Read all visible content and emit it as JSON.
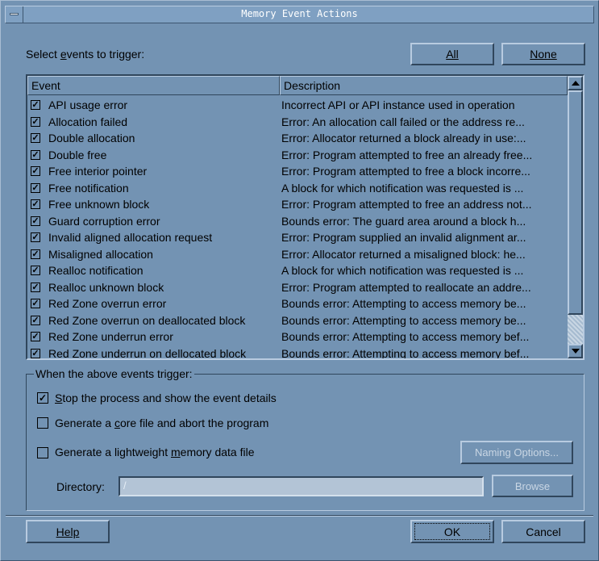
{
  "window": {
    "title": "Memory Event Actions"
  },
  "select_label_pre": "Select ",
  "select_label_ul": "e",
  "select_label_post": "vents to trigger:",
  "buttons": {
    "all": "All",
    "none": "None",
    "naming_options": "Naming Options...",
    "browse": "Browse",
    "help": "Help",
    "ok": "OK",
    "cancel": "Cancel"
  },
  "table": {
    "columns": [
      "Event",
      "Description"
    ],
    "rows": [
      {
        "event": "API usage error",
        "desc": "Incorrect API or API instance used in operation",
        "checked": true
      },
      {
        "event": "Allocation failed",
        "desc": "Error: An allocation call failed or the address re...",
        "checked": true
      },
      {
        "event": "Double allocation",
        "desc": "Error: Allocator returned a block already in use:...",
        "checked": true
      },
      {
        "event": "Double free",
        "desc": "Error: Program attempted to free an already free...",
        "checked": true
      },
      {
        "event": "Free interior pointer",
        "desc": "Error: Program attempted to free a block incorre...",
        "checked": true
      },
      {
        "event": "Free notification",
        "desc": "A block for which notification was requested is ...",
        "checked": true
      },
      {
        "event": "Free unknown block",
        "desc": "Error: Program attempted to free an address not...",
        "checked": true
      },
      {
        "event": "Guard corruption error",
        "desc": "Bounds error: The guard area around a block h...",
        "checked": true
      },
      {
        "event": "Invalid aligned allocation request",
        "desc": "Error: Program supplied an invalid alignment ar...",
        "checked": true
      },
      {
        "event": "Misaligned allocation",
        "desc": "Error: Allocator returned a misaligned block: he...",
        "checked": true
      },
      {
        "event": "Realloc notification",
        "desc": "A block for which notification was requested is ...",
        "checked": true
      },
      {
        "event": "Realloc unknown block",
        "desc": "Error: Program attempted to reallocate an addre...",
        "checked": true
      },
      {
        "event": "Red Zone overrun error",
        "desc": "Bounds error: Attempting to access memory be...",
        "checked": true
      },
      {
        "event": "Red Zone overrun on deallocated block",
        "desc": "Bounds error: Attempting to access memory be...",
        "checked": true
      },
      {
        "event": "Red Zone underrun error",
        "desc": "Bounds error: Attempting to access memory bef...",
        "checked": true
      },
      {
        "event": "Red Zone underrun on dellocated block",
        "desc": "Bounds error: Attempting to access memory bef...",
        "checked": true
      }
    ]
  },
  "group": {
    "title": "When the above events trigger:",
    "stop_pre": "",
    "stop_ul": "S",
    "stop_post": "top the process and show the event details",
    "stop_checked": true,
    "core_pre": "Generate a ",
    "core_ul": "c",
    "core_post": "ore file and abort the program",
    "core_checked": false,
    "light_pre": "Generate a lightweight ",
    "light_ul": "m",
    "light_post": "emory data file",
    "light_checked": false,
    "directory_label": "Directory:",
    "directory_value": "/"
  }
}
